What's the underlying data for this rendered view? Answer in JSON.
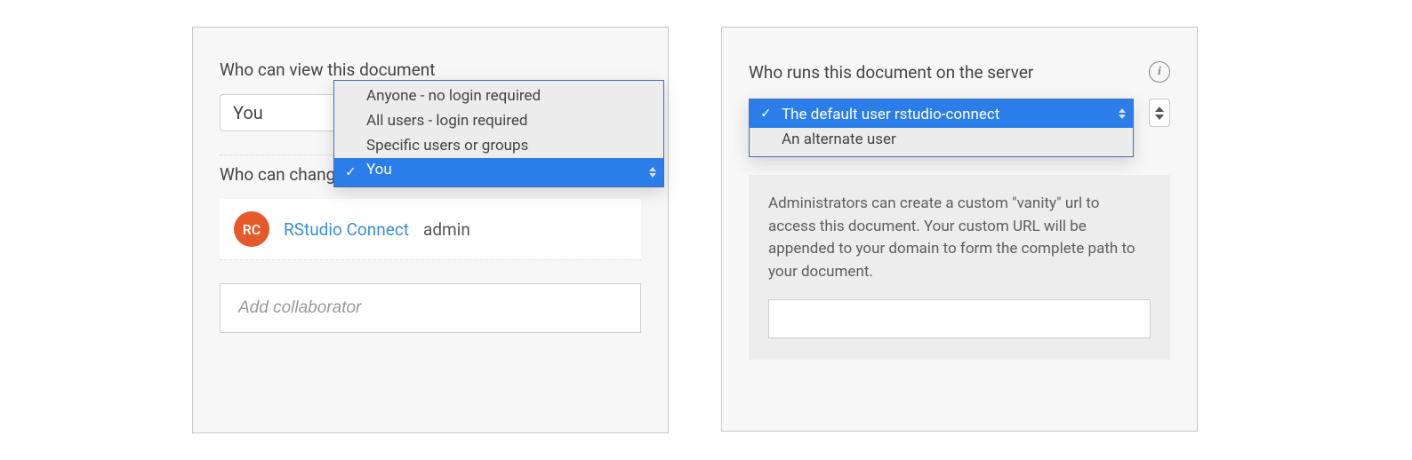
{
  "left": {
    "view_title": "Who can view this document",
    "view_select_value": "You",
    "view_options": [
      "Anyone - no login required",
      "All users - login required",
      "Specific users or groups",
      "You"
    ],
    "view_selected_index": 3,
    "change_title": "Who can change this document",
    "owner": {
      "initials": "RC",
      "name": "RStudio Connect",
      "role": "admin"
    },
    "add_collab_placeholder": "Add collaborator"
  },
  "right": {
    "runas_title": "Who runs this document on the server",
    "runas_options": [
      "The default user rstudio-connect",
      "An alternate user"
    ],
    "runas_selected_index": 0,
    "vanity_help": "Administrators can create a custom \"vanity\" url to access this document. Your custom URL will be appended to your domain to form the complete path to your document.",
    "vanity_value": ""
  }
}
